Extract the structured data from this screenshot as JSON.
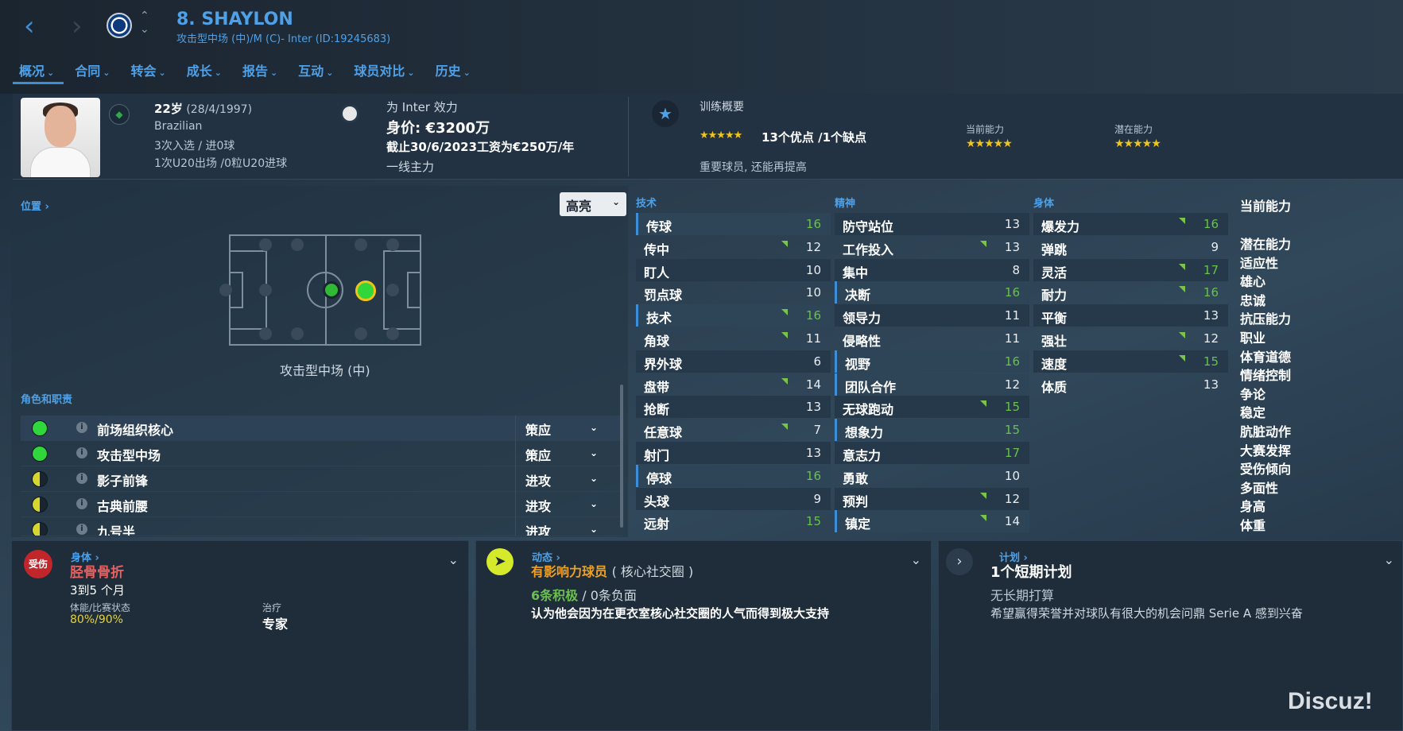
{
  "header": {
    "player_title": "8. SHAYLON",
    "subtitle": "攻击型中场 (中)/M (C)- Inter (ID:19245683)",
    "back_icon": "back-arrow-icon",
    "forward_icon": "forward-arrow-icon",
    "menu": [
      {
        "label": "概况"
      },
      {
        "label": "合同"
      },
      {
        "label": "转会"
      },
      {
        "label": "成长"
      },
      {
        "label": "报告"
      },
      {
        "label": "互动"
      },
      {
        "label": "球员对比"
      },
      {
        "label": "历史"
      }
    ]
  },
  "info": {
    "age": "22岁",
    "dob": "(28/4/1997)",
    "nationality": "Brazilian",
    "caps": "3次入选 / 进0球",
    "u20": "1次U20出场 /0粒U20进球",
    "plays_for": "为 Inter 效力",
    "value": "身价: €3200万",
    "wage": "截止30/6/2023工资为€250万/年",
    "squad_status": "一线主力",
    "training_title": "训练概要",
    "training_stars": "★★★★★",
    "training_text": "13个优点 /1个缺点",
    "training_note": "重要球员, 还能再提高",
    "current_ability_label": "当前能力",
    "current_ability_stars": "★★★★★",
    "potential_ability_label": "潜在能力",
    "potential_ability_stars": "★★★★★"
  },
  "position": {
    "label": "位置 ›",
    "highlight_btn": "高亮",
    "position_name": "攻击型中场 (中)"
  },
  "roles": {
    "label": "角色和职责",
    "items": [
      {
        "name": "前场组织核心",
        "duty": "策应",
        "color": "#2fd63c"
      },
      {
        "name": "攻击型中场",
        "duty": "策应",
        "color": "#2fd63c"
      },
      {
        "name": "影子前锋",
        "duty": "进攻",
        "color": "#d6d62f"
      },
      {
        "name": "古典前腰",
        "duty": "进攻",
        "color": "#d6d62f"
      },
      {
        "name": "九号半",
        "duty": "进攻",
        "color": "#d6d62f"
      }
    ]
  },
  "attributes": {
    "technical_label": "技术",
    "mental_label": "精神",
    "physical_label": "身体",
    "technical": [
      {
        "name": "传球",
        "value": "16"
      },
      {
        "name": "传中",
        "value": "12"
      },
      {
        "name": "盯人",
        "value": "10"
      },
      {
        "name": "罚点球",
        "value": "10"
      },
      {
        "name": "技术",
        "value": "16"
      },
      {
        "name": "角球",
        "value": "11"
      },
      {
        "name": "界外球",
        "value": "6"
      },
      {
        "name": "盘带",
        "value": "14"
      },
      {
        "name": "抢断",
        "value": "13"
      },
      {
        "name": "任意球",
        "value": "7"
      },
      {
        "name": "射门",
        "value": "13"
      },
      {
        "name": "停球",
        "value": "16"
      },
      {
        "name": "头球",
        "value": "9"
      },
      {
        "name": "远射",
        "value": "15"
      }
    ],
    "mental": [
      {
        "name": "防守站位",
        "value": "13"
      },
      {
        "name": "工作投入",
        "value": "13"
      },
      {
        "name": "集中",
        "value": "8"
      },
      {
        "name": "决断",
        "value": "16"
      },
      {
        "name": "领导力",
        "value": "11"
      },
      {
        "name": "侵略性",
        "value": "11"
      },
      {
        "name": "视野",
        "value": "16"
      },
      {
        "name": "团队合作",
        "value": "12"
      },
      {
        "name": "无球跑动",
        "value": "15"
      },
      {
        "name": "想象力",
        "value": "15"
      },
      {
        "name": "意志力",
        "value": "17"
      },
      {
        "name": "勇敢",
        "value": "10"
      },
      {
        "name": "预判",
        "value": "12"
      },
      {
        "name": "镇定",
        "value": "14"
      }
    ],
    "physical": [
      {
        "name": "爆发力",
        "value": "16"
      },
      {
        "name": "弹跳",
        "value": "9"
      },
      {
        "name": "灵活",
        "value": "17"
      },
      {
        "name": "耐力",
        "value": "16"
      },
      {
        "name": "平衡",
        "value": "13"
      },
      {
        "name": "强壮",
        "value": "12"
      },
      {
        "name": "速度",
        "value": "15"
      },
      {
        "name": "体质",
        "value": "13"
      }
    ]
  },
  "side_list": {
    "title": "当前能力",
    "items": [
      "潜在能力",
      "适应性",
      "雄心",
      "忠诚",
      "抗压能力",
      "职业",
      "体育道德",
      "情绪控制",
      "争论",
      "稳定",
      "肮脏动作",
      "大赛发挥",
      "受伤倾向",
      "多面性",
      "身高",
      "体重"
    ]
  },
  "body_panel": {
    "title": "身体 ›",
    "injury_badge": "受伤",
    "injury": "胫骨骨折",
    "duration": "3到5 个月",
    "condition_label": "体能/比赛状态",
    "condition_value": "80%/90%",
    "treatment_label": "治疗",
    "treatment_value": "专家"
  },
  "dynamics_panel": {
    "title": "动态 ›",
    "role": "有影响力球员",
    "role_group": "( 核心社交圈 )",
    "positive": "6条积极",
    "negative": " / 0条负面",
    "note": "认为他会因为在更衣室核心社交圈的人气而得到极大支持"
  },
  "plans_panel": {
    "title": "计划 ›",
    "plan_title": "1个短期计划",
    "plan_sub": "无长期打算",
    "plan_note": "希望赢得荣誉并对球队有很大的机会问鼎 Serie A 感到兴奋"
  },
  "watermark": "Discuz!"
}
